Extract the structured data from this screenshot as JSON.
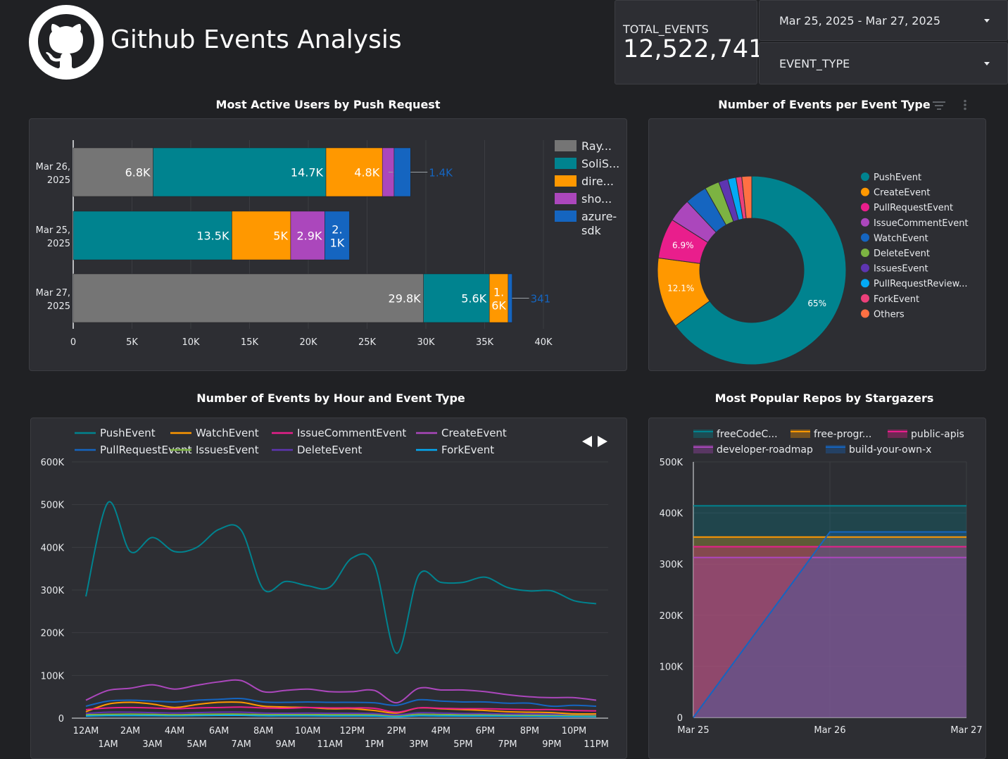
{
  "header": {
    "title": "Github Events Analysis",
    "total_label": "TOTAL_EVENTS",
    "total_value": "12,522,741",
    "date_range": "Mar 25, 2025 - Mar 27, 2025",
    "event_type_filter": "EVENT_TYPE"
  },
  "colors": {
    "teal": "#00838f",
    "orange": "#ff9800",
    "pink": "#e91e8c",
    "purple": "#ab47bc",
    "blue": "#1565c0",
    "green": "#7cb342",
    "deep_purple": "#5e35b1",
    "light_blue": "#03a9f4",
    "red_pink": "#ec407a",
    "coral": "#ff7043",
    "grey": "#757575"
  },
  "chart_data": [
    {
      "type": "bar",
      "orientation": "horizontal-stacked",
      "title": "Most Active Users by Push Request",
      "categories": [
        "Mar 26, 2025",
        "Mar 25, 2025",
        "Mar 27, 2025"
      ],
      "category_lines": [
        [
          "Mar 26,",
          "2025"
        ],
        [
          "Mar 25,",
          "2025"
        ],
        [
          "Mar 27,",
          "2025"
        ]
      ],
      "series": [
        {
          "name": "Ray...",
          "color": "#757575",
          "values": [
            6800,
            0,
            29800
          ],
          "labels": [
            "6.8K",
            "",
            "29.8K"
          ]
        },
        {
          "name": "SoliS...",
          "color": "#00838f",
          "values": [
            14700,
            13500,
            5600
          ],
          "labels": [
            "14.7K",
            "13.5K",
            "5.6K"
          ]
        },
        {
          "name": "dire...",
          "color": "#ff9800",
          "values": [
            4800,
            5000,
            1600
          ],
          "labels": [
            "4.8K",
            "5K",
            "1.6K"
          ]
        },
        {
          "name": "sho...",
          "color": "#ab47bc",
          "values": [
            1000,
            2900,
            0
          ],
          "labels": [
            "1K",
            "2.9K",
            ""
          ]
        },
        {
          "name": "azure-sdk",
          "color": "#1565c0",
          "values": [
            1400,
            2100,
            341
          ],
          "labels": [
            "1.4K",
            "2.1K",
            "341"
          ]
        }
      ],
      "legend_lines": [
        [
          "Ray..."
        ],
        [
          "SoliS..."
        ],
        [
          "dire..."
        ],
        [
          "sho..."
        ],
        [
          "azure-",
          "sdk"
        ]
      ],
      "xlim": [
        0,
        40000
      ],
      "xticks": [
        "0",
        "5K",
        "10K",
        "15K",
        "20K",
        "25K",
        "30K",
        "35K",
        "40K"
      ],
      "grid": true,
      "legend": "right"
    },
    {
      "type": "pie",
      "variant": "donut",
      "title": "Number of Events per Event Type",
      "slices": [
        {
          "name": "PushEvent",
          "value": 65,
          "label": "65%",
          "color": "#00838f"
        },
        {
          "name": "CreateEvent",
          "value": 12.1,
          "label": "12.1%",
          "color": "#ff9800"
        },
        {
          "name": "PullRequestEvent",
          "value": 6.9,
          "label": "6.9%",
          "color": "#e91e8c"
        },
        {
          "name": "IssueCommentEvent",
          "value": 4.0,
          "label": "",
          "color": "#ab47bc"
        },
        {
          "name": "WatchEvent",
          "value": 3.8,
          "label": "",
          "color": "#1565c0"
        },
        {
          "name": "DeleteEvent",
          "value": 2.5,
          "label": "",
          "color": "#7cb342"
        },
        {
          "name": "IssuesEvent",
          "value": 1.6,
          "label": "",
          "color": "#5e35b1"
        },
        {
          "name": "PullRequestReview...",
          "value": 1.4,
          "label": "",
          "color": "#03a9f4"
        },
        {
          "name": "ForkEvent",
          "value": 1.0,
          "label": "",
          "color": "#ec407a"
        },
        {
          "name": "Others",
          "value": 1.7,
          "label": "",
          "color": "#ff7043"
        }
      ],
      "legend": "right"
    },
    {
      "type": "line",
      "title": "Number of Events by Hour and Event Type",
      "x": [
        "12AM",
        "1AM",
        "2AM",
        "3AM",
        "4AM",
        "5AM",
        "6AM",
        "7AM",
        "8AM",
        "9AM",
        "10AM",
        "11AM",
        "12PM",
        "1PM",
        "2PM",
        "3PM",
        "4PM",
        "5PM",
        "6PM",
        "7PM",
        "8PM",
        "9PM",
        "10PM",
        "11PM"
      ],
      "series": [
        {
          "name": "PushEvent",
          "color": "#00838f",
          "values": [
            285000,
            505000,
            390000,
            423000,
            390000,
            400000,
            442000,
            440000,
            302000,
            320000,
            310000,
            307000,
            375000,
            360000,
            152000,
            335000,
            318000,
            318000,
            330000,
            306000,
            298000,
            298000,
            275000,
            268000
          ]
        },
        {
          "name": "WatchEvent",
          "color": "#ff9800",
          "values": [
            15000,
            33000,
            37000,
            33000,
            25000,
            32000,
            37000,
            37000,
            28000,
            26000,
            25000,
            22000,
            22000,
            18000,
            12000,
            24000,
            22000,
            20000,
            18000,
            15000,
            14000,
            13000,
            10000,
            10000
          ]
        },
        {
          "name": "IssueCommentEvent",
          "color": "#e91e8c",
          "values": [
            20000,
            24000,
            25000,
            24000,
            22000,
            24000,
            25000,
            26000,
            24000,
            23000,
            25000,
            24000,
            24000,
            23000,
            14000,
            24000,
            23000,
            22000,
            22000,
            21000,
            20000,
            20000,
            18000,
            17000
          ]
        },
        {
          "name": "CreateEvent",
          "color": "#ab47bc",
          "values": [
            42000,
            65000,
            70000,
            78000,
            68000,
            77000,
            85000,
            88000,
            62000,
            65000,
            68000,
            62000,
            62000,
            65000,
            36000,
            70000,
            66000,
            66000,
            62000,
            55000,
            50000,
            48000,
            48000,
            42000
          ]
        },
        {
          "name": "PullRequestEvent",
          "color": "#1565c0",
          "values": [
            28000,
            40000,
            42000,
            40000,
            38000,
            42000,
            44000,
            46000,
            38000,
            37000,
            38000,
            37000,
            37000,
            36000,
            30000,
            43000,
            40000,
            38000,
            38000,
            35000,
            35000,
            28000,
            30000,
            28000
          ]
        },
        {
          "name": "IssuesEvent",
          "color": "#7cb342",
          "values": [
            8000,
            9000,
            9500,
            9000,
            8000,
            9000,
            9500,
            9500,
            8500,
            8500,
            8500,
            8000,
            8000,
            8000,
            6000,
            9000,
            8500,
            8000,
            8000,
            7500,
            7000,
            7000,
            6500,
            6000
          ]
        },
        {
          "name": "DeleteEvent",
          "color": "#5e35b1",
          "values": [
            11000,
            14000,
            14000,
            13000,
            12000,
            13000,
            14000,
            14000,
            12000,
            11500,
            12000,
            11500,
            11500,
            11000,
            8000,
            12500,
            12000,
            11000,
            11000,
            10000,
            10000,
            9500,
            9000,
            8500
          ]
        },
        {
          "name": "ForkEvent",
          "color": "#03a9f4",
          "values": [
            5000,
            6000,
            6000,
            6000,
            5500,
            6000,
            6500,
            6500,
            5500,
            5500,
            5500,
            5200,
            5200,
            5000,
            3500,
            5500,
            5200,
            5000,
            5000,
            4800,
            4500,
            4300,
            4000,
            3800
          ]
        }
      ],
      "ylim": [
        0,
        600000
      ],
      "yticks": [
        "0",
        "100K",
        "200K",
        "300K",
        "400K",
        "500K",
        "600K"
      ],
      "grid": true,
      "legend": "top"
    },
    {
      "type": "area",
      "title": "Most Popular Repos by Stargazers",
      "x": [
        "Mar 25",
        "Mar 26",
        "Mar 27"
      ],
      "series": [
        {
          "name": "freeCodeC...",
          "color": "#00838f",
          "values": [
            414000,
            414000,
            414000
          ]
        },
        {
          "name": "free-progr...",
          "color": "#ff9800",
          "values": [
            353000,
            353000,
            353000
          ]
        },
        {
          "name": "public-apis",
          "color": "#e91e8c",
          "values": [
            334000,
            334000,
            334000
          ]
        },
        {
          "name": "developer-roadmap",
          "color": "#ab47bc",
          "values": [
            313000,
            313000,
            313000
          ]
        },
        {
          "name": "build-your-own-x",
          "color": "#1565c0",
          "values": [
            0,
            363000,
            363000
          ]
        }
      ],
      "ylim": [
        0,
        500000
      ],
      "yticks": [
        "0",
        "100K",
        "200K",
        "300K",
        "400K",
        "500K"
      ],
      "grid": true,
      "legend": "top"
    }
  ]
}
